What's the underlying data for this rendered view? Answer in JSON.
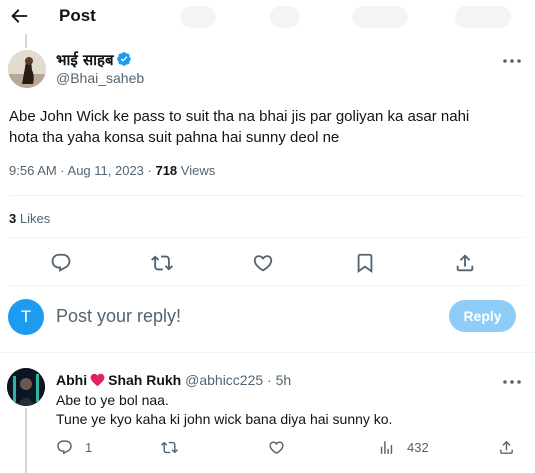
{
  "header": {
    "title": "Post"
  },
  "tweet": {
    "author_name": "भाई साहब",
    "author_handle": "@Bhai_saheb",
    "text_line1": "Abe John Wick ke pass to suit tha na bhai jis par goliyan ka asar nahi",
    "text_line2": "hota tha yaha konsa suit pahna hai sunny deol ne",
    "time": "9:56 AM · Aug 11, 2023 · ",
    "views_count": "718",
    "views_label": " Views",
    "likes_count": "3",
    "likes_label": " Likes"
  },
  "actions": [
    "reply-icon",
    "retweet-icon",
    "like-icon",
    "bookmark-icon",
    "share-icon"
  ],
  "composer": {
    "avatar_letter": "T",
    "placeholder": "Post your reply!",
    "reply_label": "Reply"
  },
  "reply": {
    "name_part1": "Abhi",
    "name_part2": "Shah Rukh",
    "handle": "@abhicc225",
    "time": " · 5h",
    "line1": "Abe to ye bol naa.",
    "line2": "Tune ye kyo kaha ki john wick bana diya hai sunny ko.",
    "reply_count": "1",
    "views_count": "432"
  },
  "colors": {
    "accent": "#1d9bf0",
    "reply_button": "#8ecdf8",
    "heart": "#e0245e",
    "muted": "#536471"
  }
}
